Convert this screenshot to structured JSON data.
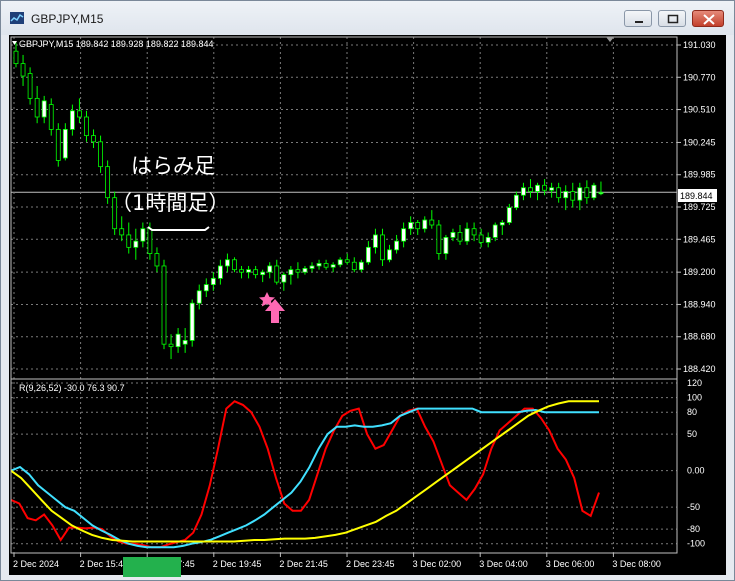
{
  "window": {
    "title": "GBPJPY,M15"
  },
  "main_chart": {
    "header": "GBPJPY,M15  189.842 189.928 189.822 189.844",
    "current_price": "189.844",
    "price_ticks": [
      "191.030",
      "190.770",
      "190.510",
      "190.245",
      "189.985",
      "189.725",
      "189.465",
      "189.200",
      "188.940",
      "188.680",
      "188.420"
    ],
    "annotation_line1": "はらみ足",
    "annotation_line2": "（1時間足）"
  },
  "indicator": {
    "header": "R(9,26,52) -30.0 76.3 90.7",
    "ticks": [
      "120",
      "100",
      "80",
      "50",
      "0.00",
      "-50",
      "-80",
      "-100"
    ]
  },
  "time_axis": [
    "2 Dec 2024",
    "2 Dec 15:45",
    "2 Dec 17:45",
    "2 Dec 19:45",
    "2 Dec 21:45",
    "2 Dec 23:45",
    "3 Dec 02:00",
    "3 Dec 04:00",
    "3 Dec 06:00",
    "3 Dec 08:00"
  ],
  "colors": {
    "bull_candle": "#ffffff",
    "bear_candle": "#000000",
    "candle_outline": "#00ff00",
    "line_red": "#ff0000",
    "line_cyan": "#40e0ff",
    "line_yellow": "#ffff00",
    "star": "#ff69b4",
    "arrow": "#ff69b4"
  },
  "chart_data": [
    {
      "type": "candlestick",
      "title": "GBPJPY,M15",
      "ylim": [
        188.42,
        191.03
      ],
      "candles": [
        [
          190.98,
          191.05,
          190.85,
          190.88
        ],
        [
          190.88,
          190.95,
          190.7,
          190.78
        ],
        [
          190.8,
          190.85,
          190.55,
          190.6
        ],
        [
          190.6,
          190.7,
          190.4,
          190.45
        ],
        [
          190.45,
          190.62,
          190.4,
          190.58
        ],
        [
          190.55,
          190.6,
          190.3,
          190.35
        ],
        [
          190.35,
          190.4,
          190.05,
          190.1
        ],
        [
          190.12,
          190.4,
          190.1,
          190.35
        ],
        [
          190.35,
          190.55,
          190.3,
          190.5
        ],
        [
          190.5,
          190.6,
          190.4,
          190.45
        ],
        [
          190.45,
          190.5,
          190.25,
          190.3
        ],
        [
          190.3,
          190.35,
          190.2,
          190.25
        ],
        [
          190.25,
          190.3,
          190.0,
          190.05
        ],
        [
          190.05,
          190.1,
          189.75,
          189.8
        ],
        [
          189.8,
          189.85,
          189.5,
          189.55
        ],
        [
          189.55,
          189.65,
          189.45,
          189.5
        ],
        [
          189.5,
          189.6,
          189.35,
          189.4
        ],
        [
          189.4,
          189.55,
          189.3,
          189.45
        ],
        [
          189.45,
          189.6,
          189.4,
          189.55
        ],
        [
          189.55,
          189.6,
          189.3,
          189.35
        ],
        [
          189.35,
          189.4,
          189.2,
          189.25
        ],
        [
          189.25,
          189.3,
          188.58,
          188.62
        ],
        [
          188.62,
          188.7,
          188.5,
          188.6
        ],
        [
          188.6,
          188.75,
          188.55,
          188.7
        ],
        [
          188.62,
          188.75,
          188.55,
          188.65
        ],
        [
          188.65,
          188.98,
          188.6,
          188.95
        ],
        [
          188.95,
          189.1,
          188.9,
          189.05
        ],
        [
          189.05,
          189.15,
          189.0,
          189.1
        ],
        [
          189.1,
          189.2,
          189.05,
          189.15
        ],
        [
          189.15,
          189.3,
          189.1,
          189.25
        ],
        [
          189.25,
          189.35,
          189.2,
          189.3
        ],
        [
          189.3,
          189.32,
          189.2,
          189.22
        ],
        [
          189.22,
          189.25,
          189.15,
          189.2
        ],
        [
          189.2,
          189.25,
          189.15,
          189.22
        ],
        [
          189.22,
          189.25,
          189.15,
          189.18
        ],
        [
          189.18,
          189.22,
          189.12,
          189.2
        ],
        [
          189.2,
          189.28,
          189.15,
          189.25
        ],
        [
          189.25,
          189.3,
          189.1,
          189.12
        ],
        [
          189.12,
          189.2,
          189.05,
          189.18
        ],
        [
          189.18,
          189.25,
          189.1,
          189.22
        ],
        [
          189.22,
          189.28,
          189.15,
          189.2
        ],
        [
          189.2,
          189.25,
          189.18,
          189.23
        ],
        [
          189.23,
          189.28,
          189.2,
          189.25
        ],
        [
          189.25,
          189.3,
          189.22,
          189.27
        ],
        [
          189.27,
          189.3,
          189.22,
          189.24
        ],
        [
          189.24,
          189.28,
          189.2,
          189.26
        ],
        [
          189.26,
          189.32,
          189.24,
          189.3
        ],
        [
          189.3,
          189.35,
          189.26,
          189.28
        ],
        [
          189.28,
          189.32,
          189.2,
          189.22
        ],
        [
          189.22,
          189.3,
          189.2,
          189.28
        ],
        [
          189.28,
          189.45,
          189.26,
          189.4
        ],
        [
          189.4,
          189.55,
          189.35,
          189.5
        ],
        [
          189.5,
          189.55,
          189.25,
          189.3
        ],
        [
          189.3,
          189.42,
          189.28,
          189.38
        ],
        [
          189.38,
          189.5,
          189.35,
          189.45
        ],
        [
          189.45,
          189.6,
          189.4,
          189.55
        ],
        [
          189.55,
          189.65,
          189.5,
          189.6
        ],
        [
          189.6,
          189.62,
          189.5,
          189.55
        ],
        [
          189.55,
          189.65,
          189.52,
          189.62
        ],
        [
          189.62,
          189.7,
          189.55,
          189.58
        ],
        [
          189.58,
          189.62,
          189.3,
          189.35
        ],
        [
          189.35,
          189.5,
          189.3,
          189.48
        ],
        [
          189.48,
          189.55,
          189.45,
          189.52
        ],
        [
          189.52,
          189.58,
          189.42,
          189.45
        ],
        [
          189.45,
          189.6,
          189.42,
          189.55
        ],
        [
          189.55,
          189.6,
          189.45,
          189.5
        ],
        [
          189.5,
          189.55,
          189.4,
          189.44
        ],
        [
          189.44,
          189.52,
          189.4,
          189.48
        ],
        [
          189.48,
          189.6,
          189.45,
          189.58
        ],
        [
          189.58,
          189.62,
          189.5,
          189.6
        ],
        [
          189.6,
          189.75,
          189.58,
          189.72
        ],
        [
          189.72,
          189.85,
          189.7,
          189.82
        ],
        [
          189.82,
          189.92,
          189.78,
          189.88
        ],
        [
          189.88,
          189.95,
          189.8,
          189.85
        ],
        [
          189.85,
          189.92,
          189.78,
          189.9
        ],
        [
          189.9,
          189.95,
          189.82,
          189.86
        ],
        [
          189.86,
          189.92,
          189.8,
          189.88
        ],
        [
          189.88,
          189.92,
          189.76,
          189.8
        ],
        [
          189.8,
          189.9,
          189.7,
          189.85
        ],
        [
          189.85,
          189.92,
          189.72,
          189.78
        ],
        [
          189.78,
          189.92,
          189.7,
          189.88
        ],
        [
          189.88,
          189.94,
          189.75,
          189.8
        ],
        [
          189.8,
          189.92,
          189.78,
          189.9
        ],
        [
          189.84,
          189.93,
          189.82,
          189.84
        ]
      ]
    },
    {
      "type": "line",
      "title": "R(9,26,52)",
      "ylim": [
        -110,
        120
      ],
      "series": [
        {
          "name": "9",
          "color": "#ff0000",
          "values": [
            -40,
            -45,
            -65,
            -68,
            -60,
            -75,
            -95,
            -78,
            -78,
            -79,
            -78,
            -80,
            -90,
            -97,
            -100,
            -100,
            -102,
            -105,
            -105,
            -101,
            -98,
            -95,
            -85,
            -60,
            -20,
            30,
            85,
            95,
            90,
            80,
            60,
            30,
            -10,
            -45,
            -55,
            -55,
            -40,
            -5,
            30,
            55,
            75,
            82,
            85,
            50,
            30,
            35,
            55,
            75,
            82,
            85,
            60,
            40,
            10,
            -20,
            -30,
            -40,
            -25,
            -5,
            30,
            55,
            65,
            75,
            85,
            85,
            72,
            55,
            30,
            15,
            -10,
            -55,
            -62,
            -30
          ]
        },
        {
          "name": "26",
          "color": "#40e0ff",
          "values": [
            0,
            5,
            -5,
            -20,
            -30,
            -40,
            -50,
            -55,
            -65,
            -75,
            -82,
            -88,
            -95,
            -100,
            -103,
            -105,
            -105,
            -105,
            -105,
            -103,
            -100,
            -98,
            -95,
            -90,
            -85,
            -80,
            -75,
            -68,
            -60,
            -50,
            -40,
            -30,
            -15,
            5,
            30,
            50,
            60,
            60,
            62,
            60,
            60,
            62,
            65,
            75,
            80,
            85,
            85,
            85,
            85,
            85,
            85,
            85,
            80,
            80,
            80,
            80,
            80,
            82,
            83,
            80,
            80,
            80,
            80,
            80,
            80,
            80
          ]
        },
        {
          "name": "52",
          "color": "#ffff00",
          "values": [
            0,
            -10,
            -25,
            -40,
            -55,
            -65,
            -75,
            -82,
            -88,
            -92,
            -95,
            -96,
            -97,
            -97,
            -97,
            -97,
            -97,
            -97,
            -97,
            -97,
            -97,
            -97,
            -97,
            -96,
            -95,
            -95,
            -94,
            -93,
            -93,
            -93,
            -92,
            -90,
            -88,
            -85,
            -80,
            -75,
            -70,
            -62,
            -55,
            -45,
            -35,
            -25,
            -15,
            -5,
            5,
            15,
            25,
            35,
            45,
            55,
            65,
            75,
            82,
            88,
            92,
            95,
            95,
            95,
            95
          ]
        }
      ],
      "ticks": [
        120,
        100,
        80,
        50,
        0,
        -50,
        -80,
        -100
      ]
    }
  ]
}
